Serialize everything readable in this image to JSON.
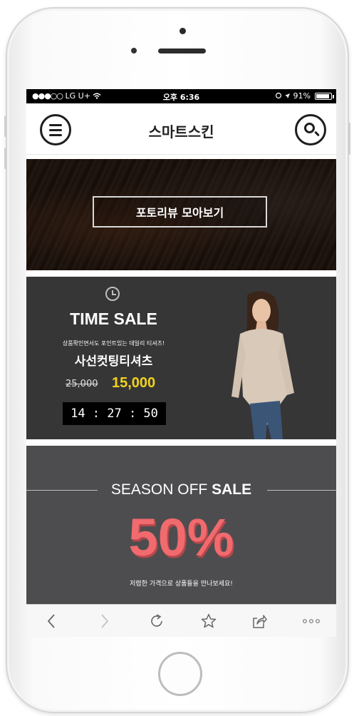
{
  "status_bar": {
    "carrier_dots": "●●●○○",
    "carrier": "LG U+",
    "time": "오후 6:36",
    "battery": "91%",
    "battery_level": 0.91
  },
  "header": {
    "title": "스마트스킨",
    "menu_icon": "hamburger-icon",
    "search_icon": "search-icon"
  },
  "photo_banner": {
    "cta_label": "포토리뷰 모아보기"
  },
  "time_sale": {
    "icon": "clock-icon",
    "title": "TIME SALE",
    "subtitle": "상품확인면서도 포인트있는 데일리 티셔츠!",
    "product": "사선컷팅티셔츠",
    "old_price": "25,000",
    "new_price": "15,000",
    "timer": "14 : 27 : 50",
    "price_color": "#f2d41c"
  },
  "season_sale": {
    "title_light": "SEASON OFF ",
    "title_bold": "SALE",
    "percent": "50%",
    "caption": "저렴한 가격으로 상품들을 만나보세요!",
    "accent_color": "#f06a6e"
  },
  "browser_toolbar": {
    "buttons": [
      "back-icon",
      "forward-icon",
      "reload-icon",
      "bookmark-star-icon",
      "share-icon",
      "more-icon"
    ]
  }
}
